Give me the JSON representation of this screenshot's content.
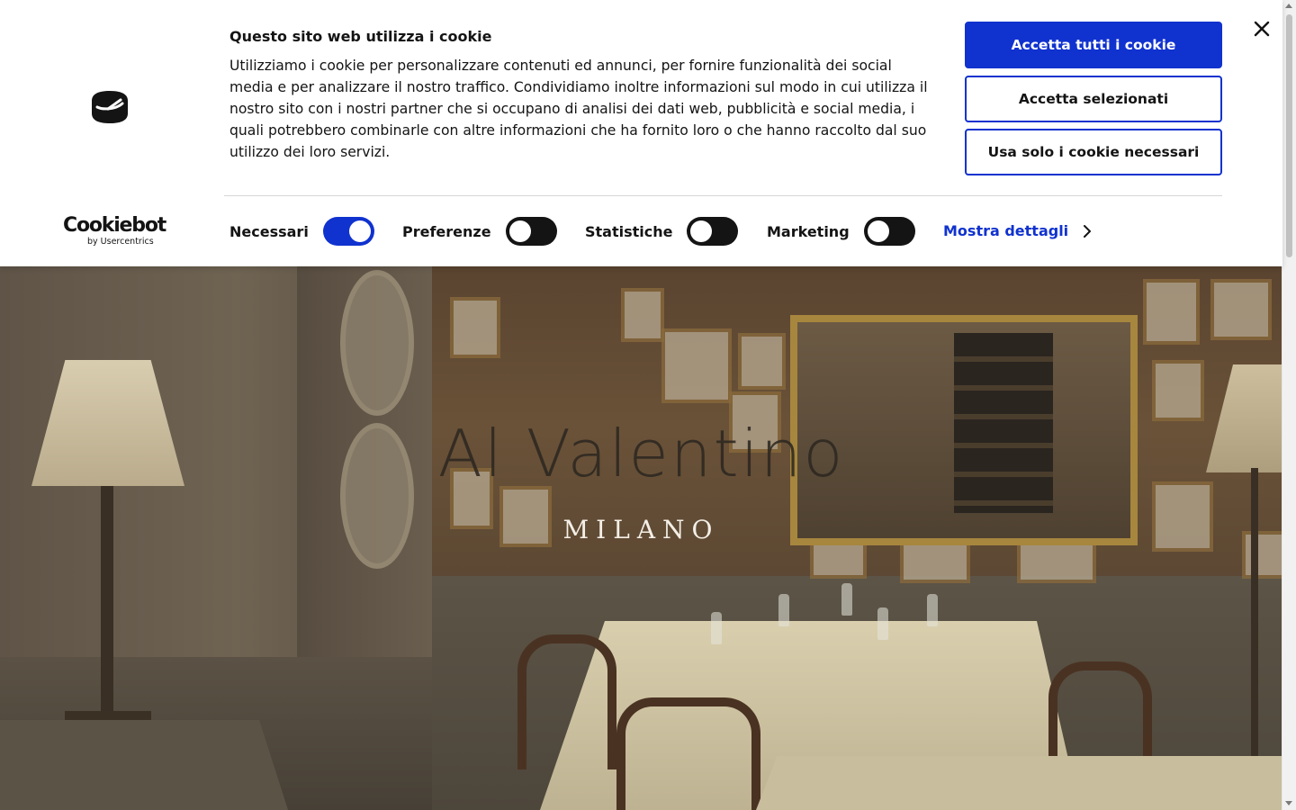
{
  "hero": {
    "title": "Al Valentino",
    "subtitle": "MILANO"
  },
  "banner": {
    "title": "Questo sito web utilizza i cookie",
    "text": "Utilizziamo i cookie per personalizzare contenuti ed annunci, per fornire funzionalità dei social media e per analizzare il nostro traffico. Condividiamo inoltre informazioni sul modo in cui utilizza il nostro sito con i nostri partner che si occupano di analisi dei dati web, pubblicità e social media, i quali potrebbero combinarle con altre informazioni che ha fornito loro o che hanno raccolto dal suo utilizzo dei loro servizi.",
    "brand": {
      "name": "Cookiebot",
      "by": "by Usercentrics"
    },
    "buttons": {
      "accept_all": "Accetta tutti i cookie",
      "accept_selected": "Accetta selezionati",
      "necessary_only": "Usa solo i cookie necessari"
    },
    "toggles": [
      {
        "label": "Necessari",
        "state": "on"
      },
      {
        "label": "Preferenze",
        "state": "off"
      },
      {
        "label": "Statistiche",
        "state": "off"
      },
      {
        "label": "Marketing",
        "state": "off"
      }
    ],
    "details_link": "Mostra dettagli",
    "icons": [
      "cookiebot-logo-icon",
      "close-icon",
      "chevron-right-icon"
    ],
    "colors": {
      "accent": "#1032cf",
      "text": "#141414",
      "background": "#ffffff"
    }
  }
}
